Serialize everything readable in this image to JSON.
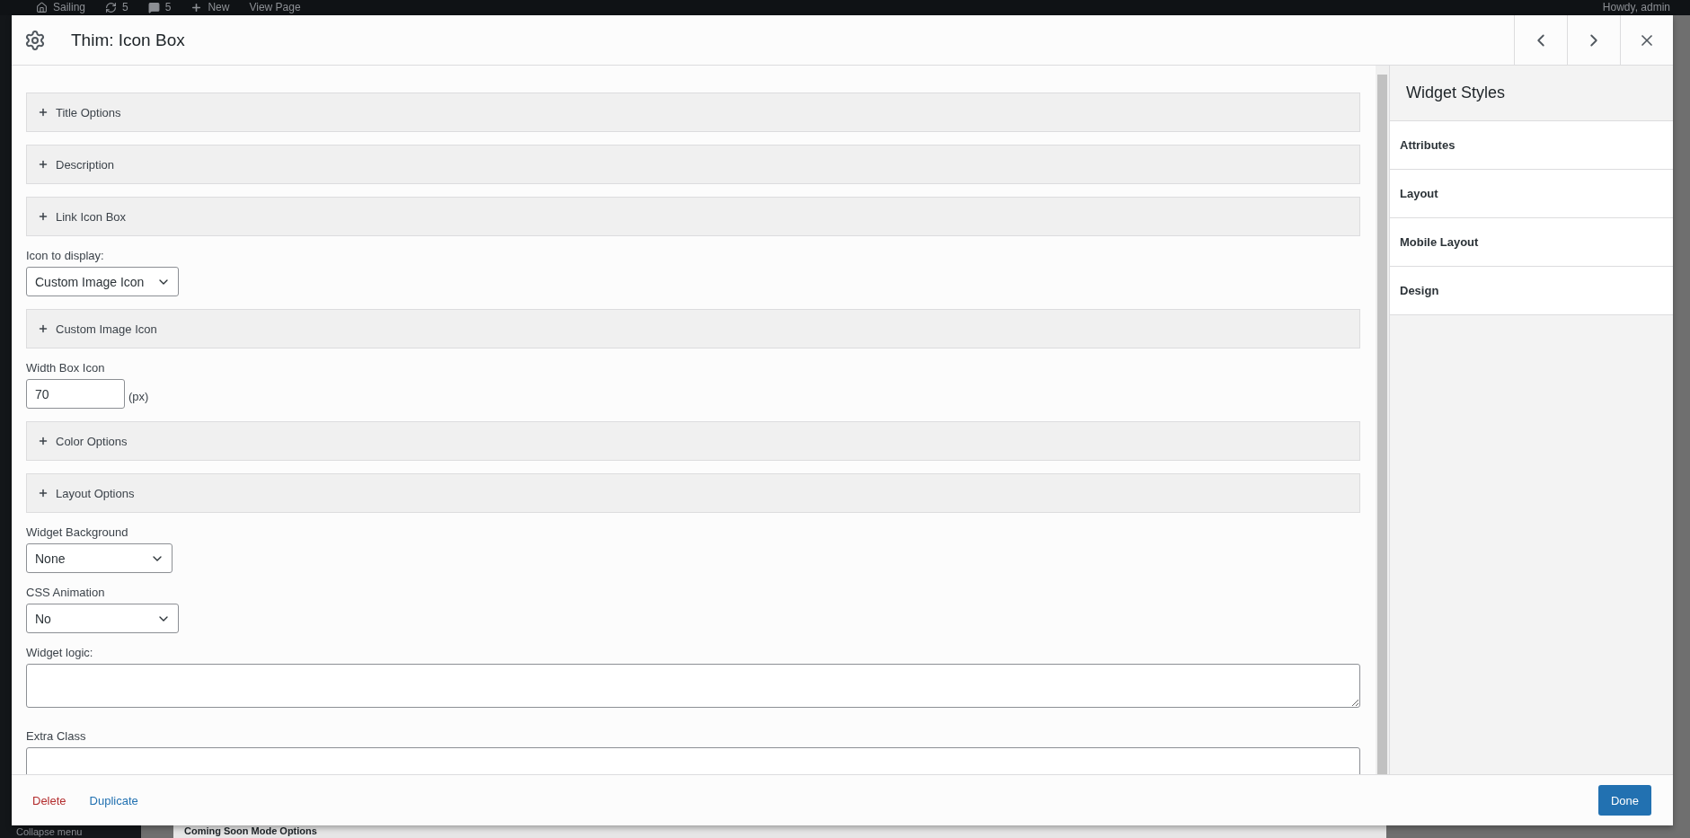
{
  "admin_bar": {
    "items": [
      {
        "kind": "site",
        "label": "Sailing"
      },
      {
        "kind": "updates",
        "label": "5"
      },
      {
        "kind": "comments",
        "label": "5"
      },
      {
        "kind": "new",
        "label": "New"
      },
      {
        "kind": "link",
        "label": "View Page"
      }
    ],
    "greeting": "Howdy, admin"
  },
  "background": {
    "collapse_menu": "Collapse menu",
    "panel_title": "Coming Soon Mode Options"
  },
  "dialog": {
    "title": "Thim: Icon Box"
  },
  "form": [
    {
      "kind": "section",
      "label": "Title Options",
      "expanded": false
    },
    {
      "kind": "section",
      "label": "Description",
      "expanded": false
    },
    {
      "kind": "section",
      "label": "Link Icon Box",
      "expanded": false
    },
    {
      "kind": "select",
      "label": "Icon to display:",
      "value": "Custom Image Icon"
    },
    {
      "kind": "section",
      "label": "Custom Image Icon",
      "expanded": false
    },
    {
      "kind": "number",
      "label": "Width Box Icon",
      "value": "70",
      "unit": "(px)"
    },
    {
      "kind": "section",
      "label": "Color Options",
      "expanded": false
    },
    {
      "kind": "section",
      "label": "Layout Options",
      "expanded": false
    },
    {
      "kind": "select",
      "label": "Widget Background",
      "value": "None"
    },
    {
      "kind": "select",
      "label": "CSS Animation",
      "value": "No"
    },
    {
      "kind": "textarea",
      "label": "Widget logic:"
    },
    {
      "kind": "text",
      "label": "Extra Class"
    }
  ],
  "sidebar": {
    "title": "Widget Styles",
    "sections": [
      "Attributes",
      "Layout",
      "Mobile Layout",
      "Design"
    ]
  },
  "footer": {
    "delete": "Delete",
    "duplicate": "Duplicate",
    "done": "Done"
  }
}
